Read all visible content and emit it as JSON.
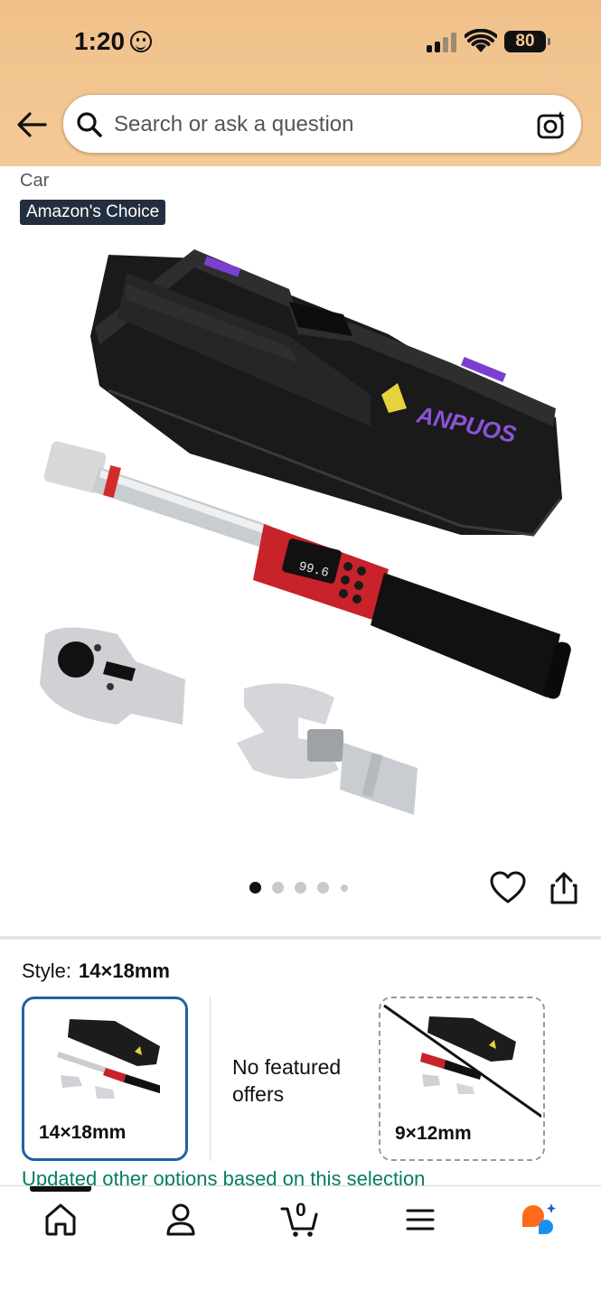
{
  "status_bar": {
    "time": "1:20",
    "battery": "80"
  },
  "search": {
    "placeholder": "Search or ask a question"
  },
  "product": {
    "title_fragment": "Car",
    "badge": "Amazon's Choice",
    "brand_on_case": "ANPUOS",
    "display_value": "99.6",
    "carousel": {
      "count": 5,
      "active_index": 0
    }
  },
  "style_selector": {
    "label": "Style:",
    "selected": "14×18mm",
    "options": [
      {
        "label": "14×18mm",
        "state": "selected"
      },
      {
        "label": "No featured offers",
        "state": "info"
      },
      {
        "label": "9×12mm",
        "state": "unavailable"
      }
    ],
    "update_notice": "Updated other options based on this selection"
  },
  "bottom_nav": {
    "items": [
      "home-icon",
      "account-icon",
      "cart-icon",
      "menu-icon",
      "rufus-icon"
    ],
    "cart_count": "0",
    "active": "home"
  },
  "colors": {
    "header": "#f5c995",
    "badge_bg": "#232f3e",
    "selected_border": "#2162a1",
    "notice_green": "#067d62",
    "rufus_orange": "#ff6a1a",
    "rufus_blue": "#1a8ff0"
  }
}
